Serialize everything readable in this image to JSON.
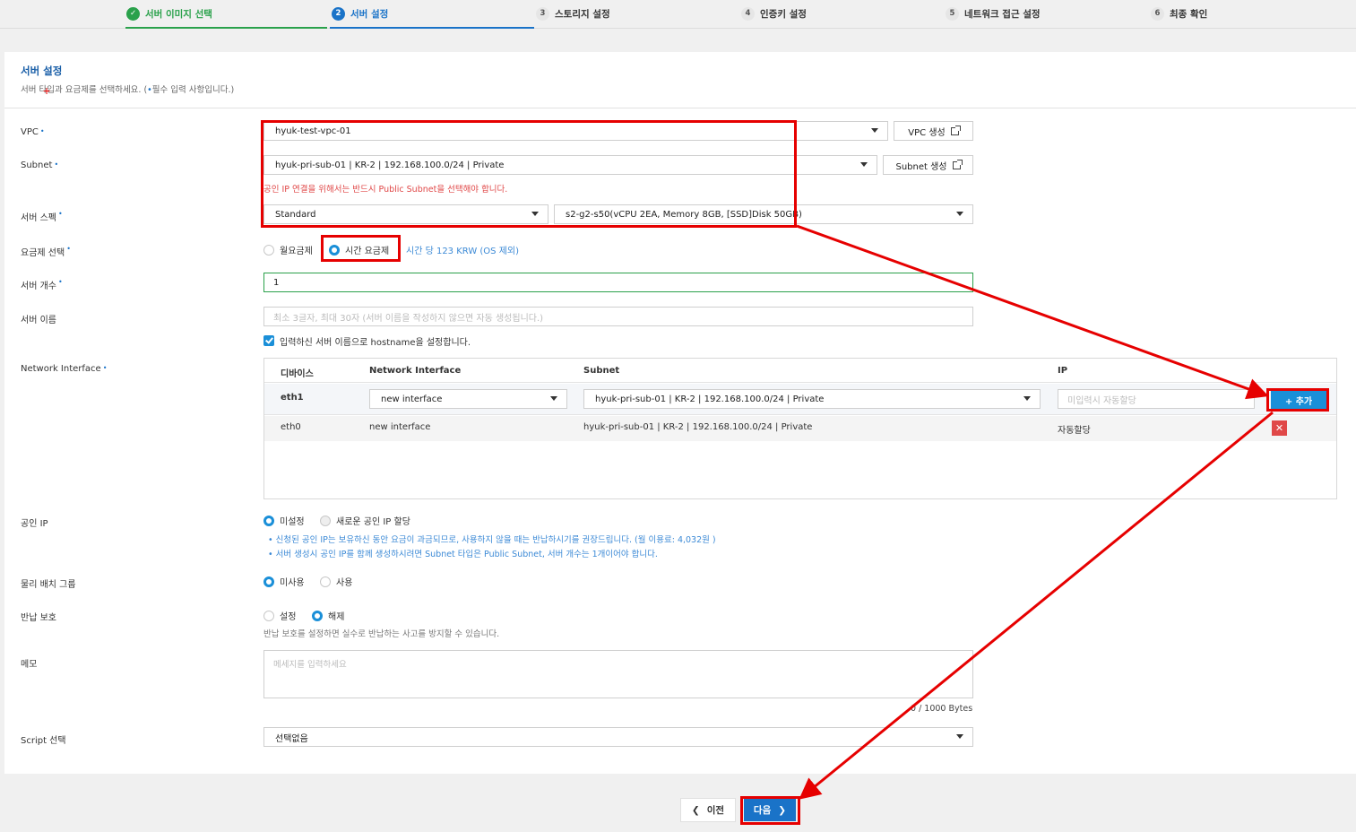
{
  "stepper": {
    "steps": [
      {
        "num": "✓",
        "label": "서버 이미지 선택",
        "state": "done"
      },
      {
        "num": "2",
        "label": "서버 설정",
        "state": "active"
      },
      {
        "num": "3",
        "label": "스토리지 설정",
        "state": "todo"
      },
      {
        "num": "4",
        "label": "인증키 설정",
        "state": "todo"
      },
      {
        "num": "5",
        "label": "네트워크 접근 설정",
        "state": "todo"
      },
      {
        "num": "6",
        "label": "최종 확인",
        "state": "todo"
      }
    ]
  },
  "panel": {
    "title": "서버 설정",
    "desc_prefix": "서버 타입과 요금제를 선택하세요. (",
    "desc_dot": "•",
    "desc_suffix": "필수 입력 사항입니다.)"
  },
  "labels": {
    "vpc": "VPC",
    "subnet": "Subnet",
    "server_spec": "서버 스펙",
    "pricing": "요금제 선택",
    "server_count": "서버 개수",
    "server_name": "서버 이름",
    "network_interface": "Network Interface",
    "public_ip": "공인 IP",
    "placement_group": "물리 배치 그룹",
    "return_protect": "반납 보호",
    "memo": "메모",
    "script": "Script 선택",
    "required_mark": "•"
  },
  "vpc": {
    "value": "hyuk-test-vpc-01",
    "create_label": "VPC 생성"
  },
  "subnet": {
    "value": "hyuk-pri-sub-01 | KR-2 | 192.168.100.0/24 | Private",
    "create_label": "Subnet 생성",
    "warning_prefix": "공인 IP 연결을 위해서는 반드시 ",
    "warning_link": "Public Subnet",
    "warning_suffix": "을 선택해야 합니다."
  },
  "spec": {
    "type": "Standard",
    "detail": "s2-g2-s50(vCPU 2EA, Memory 8GB, [SSD]Disk 50GB)"
  },
  "pricing": {
    "monthly": "월요금제",
    "hourly": "시간 요금제",
    "hourly_price": "시간 당 123 KRW (OS 제외)"
  },
  "server_count": {
    "value": "1"
  },
  "server_name": {
    "placeholder": "최소 3글자, 최대 30자 (서버 이름을 작성하지 않으면 자동 생성됩니다.)",
    "hostname_check": "입력하신 서버 이름으로 hostname을 설정합니다."
  },
  "network_table": {
    "headers": [
      "디바이스",
      "Network Interface",
      "Subnet",
      "IP"
    ],
    "row1": {
      "device": "eth1",
      "interface": "new interface",
      "subnet": "hyuk-pri-sub-01 | KR-2 | 192.168.100.0/24 | Private",
      "ip_placeholder": "미입력시 자동할당",
      "add_label": "+ 추가"
    },
    "row2": {
      "device": "eth0",
      "interface": "new interface",
      "subnet": "hyuk-pri-sub-01 | KR-2 | 192.168.100.0/24 | Private",
      "ip": "자동할당",
      "delete_label": "✕"
    }
  },
  "public_ip": {
    "none": "미설정",
    "new": "새로운 공인 IP 할당",
    "note1": "•  신청된 공인 IP는 보유하신 동안 요금이 과금되므로, 사용하지 않을 때는 반납하시기를 권장드립니다. (월 이용료: 4,032원 )",
    "note2": "•  서버 생성시 공인 IP를 함께 생성하시려면 Subnet 타입은 Public Subnet, 서버 개수는 1개이어야 합니다."
  },
  "placement_group": {
    "unused": "미사용",
    "used": "사용"
  },
  "return_protect": {
    "set": "설정",
    "unset": "해제",
    "hint": "반납 보호를 설정하면 실수로 반납하는 사고를 방지할 수 있습니다."
  },
  "memo": {
    "placeholder": "메세지를 입력하세요",
    "counter": "0 / 1000 Bytes"
  },
  "script": {
    "value": "선택없음"
  },
  "footer": {
    "prev": "이전",
    "next": "다음"
  },
  "colors": {
    "annotation": "#e60000",
    "accent": "#1a73c8",
    "success": "#2aa14b"
  }
}
